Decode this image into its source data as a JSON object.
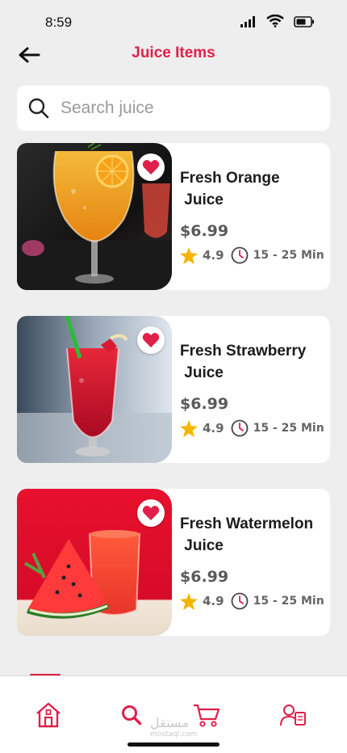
{
  "status": {
    "time": "8:59"
  },
  "header": {
    "title": "Juice Items"
  },
  "search": {
    "placeholder": "Search juice"
  },
  "items": [
    {
      "name_line1": "Fresh Orange",
      "name_line2": " Juice",
      "price": "$6.99",
      "rating": "4.9",
      "time": "15 - 25 Min"
    },
    {
      "name_line1": "Fresh Strawberry",
      "name_line2": " Juice",
      "price": "$6.99",
      "rating": "4.9",
      "time": "15 - 25 Min"
    },
    {
      "name_line1": "Fresh Watermelon",
      "name_line2": " Juice",
      "price": "$6.99",
      "rating": "4.9",
      "time": "15 - 25 Min"
    }
  ],
  "nav": {
    "items": [
      "home-icon",
      "search-icon",
      "cart-icon",
      "profile-icon"
    ],
    "active": "search-icon"
  },
  "watermark": {
    "arabic": "مستقل",
    "latin": "mostaql.com"
  },
  "colors": {
    "accent": "#e0204a",
    "star": "#f4b400",
    "background": "#eeeeee"
  }
}
